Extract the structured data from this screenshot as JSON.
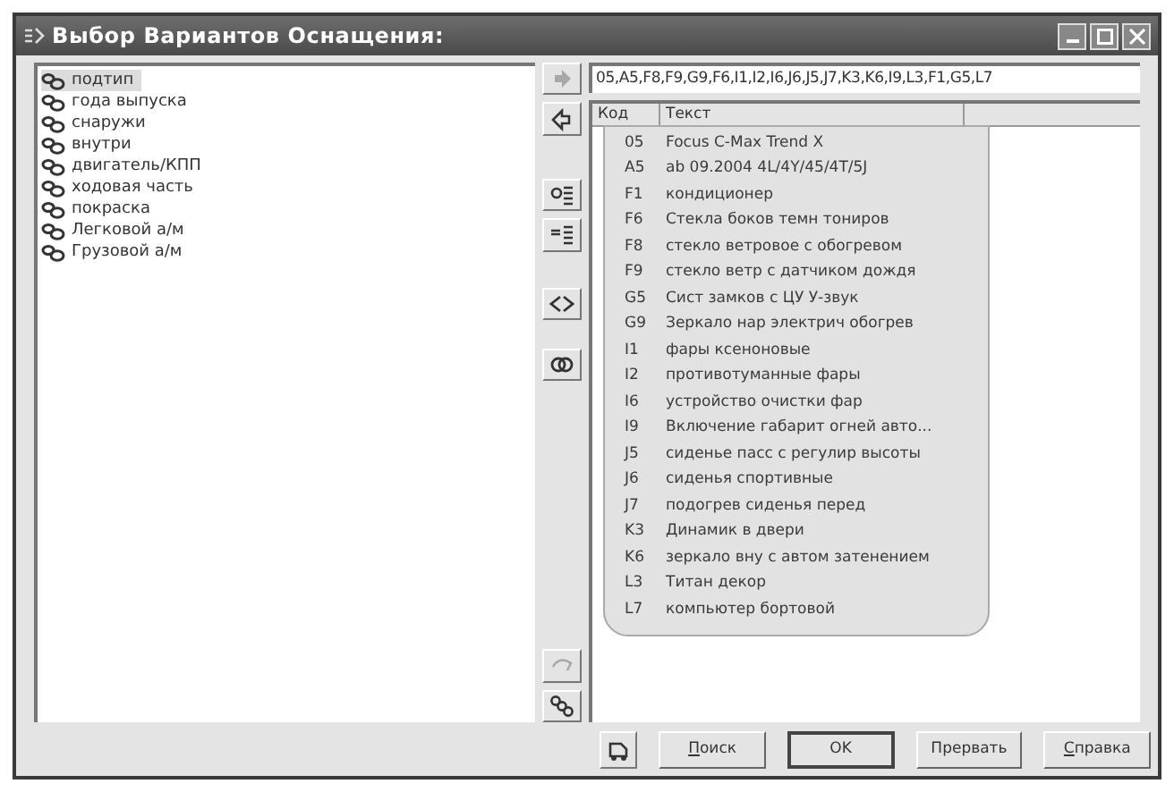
{
  "window": {
    "title": "Выбор Вариантов Оснащения:"
  },
  "tree": {
    "items": [
      {
        "label": "подтип",
        "selected": true
      },
      {
        "label": "года выпуска",
        "selected": false
      },
      {
        "label": "снаружи",
        "selected": false
      },
      {
        "label": "внутри",
        "selected": false
      },
      {
        "label": "двигатель/КПП",
        "selected": false
      },
      {
        "label": "ходовая часть",
        "selected": false
      },
      {
        "label": "покраска",
        "selected": false
      },
      {
        "label": "Легковой а/м",
        "selected": false
      },
      {
        "label": "Грузовой а/м",
        "selected": false
      }
    ]
  },
  "toolbar": [
    {
      "kind": "arrow-right",
      "disabled": true
    },
    {
      "kind": "arrow-left",
      "disabled": false
    },
    {
      "kind": "list-a",
      "disabled": false
    },
    {
      "kind": "list-b",
      "disabled": false
    },
    {
      "kind": "swap",
      "disabled": false
    },
    {
      "kind": "link",
      "disabled": false
    },
    {
      "kind": "unlink",
      "disabled": true
    },
    {
      "kind": "chain",
      "disabled": false
    }
  ],
  "codes_field": {
    "value": "05,A5,F8,F9,G9,F6,I1,I2,I6,J6,J5,J7,K3,K6,I9,L3,F1,G5,L7"
  },
  "table": {
    "columns": [
      "Код",
      "Текст"
    ],
    "rows": [
      {
        "code": "05",
        "text": "Focus C-Max Trend X"
      },
      {
        "code": "A5",
        "text": "ab 09.2004 4L/4Y/45/4T/5J"
      },
      {
        "code": "F1",
        "text": "кондиционер"
      },
      {
        "code": "F6",
        "text": "Стекла боков темн тониров"
      },
      {
        "code": "F8",
        "text": "стекло ветровое с обогревом"
      },
      {
        "code": "F9",
        "text": "стекло ветр с датчиком дождя"
      },
      {
        "code": "G5",
        "text": "Сист замков с ЦУ У-звук"
      },
      {
        "code": "G9",
        "text": "Зеркало нар электрич обогрев"
      },
      {
        "code": "I1",
        "text": "фары ксеноновые"
      },
      {
        "code": "I2",
        "text": "противотуманные фары"
      },
      {
        "code": "I6",
        "text": "устройство очистки фар"
      },
      {
        "code": "I9",
        "text": "Включение габарит огней авто..."
      },
      {
        "code": "J5",
        "text": "сиденье пасс с регулир высоты"
      },
      {
        "code": "J6",
        "text": "сиденья спортивные"
      },
      {
        "code": "J7",
        "text": "подогрев сиденья перед"
      },
      {
        "code": "K3",
        "text": "Динамик в двери"
      },
      {
        "code": "K6",
        "text": "зеркало вну с автом затенением"
      },
      {
        "code": "L3",
        "text": "Титан декор"
      },
      {
        "code": "L7",
        "text": "компьютер бортовой"
      }
    ]
  },
  "buttons": [
    {
      "label": "Поиск",
      "underline_first": true,
      "default": false
    },
    {
      "label": "OK",
      "underline_first": false,
      "default": true
    },
    {
      "label": "Прервать",
      "underline_first": false,
      "default": false
    },
    {
      "label": "Справка",
      "underline_first": true,
      "default": false
    }
  ]
}
